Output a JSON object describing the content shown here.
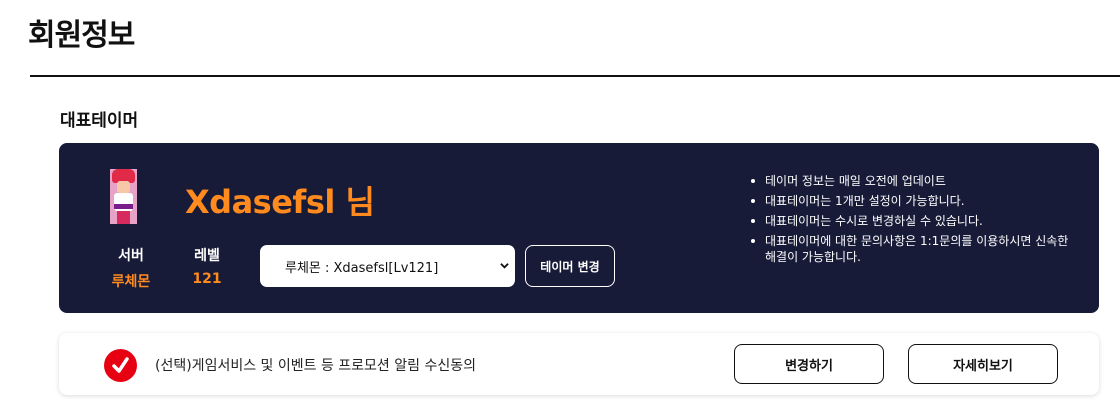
{
  "page": {
    "title": "회원정보"
  },
  "representative": {
    "section_title": "대표테이머",
    "name": "Xdasefsl 님",
    "server_label": "서버",
    "server_value": "루체몬",
    "level_label": "레벨",
    "level_value": "121",
    "select_value": "루체몬 : Xdasefsl[Lv121]",
    "change_button": "테이머 변경",
    "info": [
      "테이머 정보는 매일 오전에 업데이트",
      "대표테이머는 1개만 설정이 가능합니다.",
      "대표테이머는 수시로 변경하실 수 있습니다.",
      "대표테이머에 대한 문의사항은 1:1문의를 이용하시면 신속한 해결이 가능합니다."
    ]
  },
  "consent": {
    "text": "(선택)게임서비스 및 이벤트 등 프로모션 알림 수신동의",
    "checked": true,
    "change_button": "변경하기",
    "detail_button": "자세히보기"
  },
  "colors": {
    "card_background": "#171b38",
    "accent_orange": "#ff8a1e",
    "check_red": "#e60012"
  }
}
